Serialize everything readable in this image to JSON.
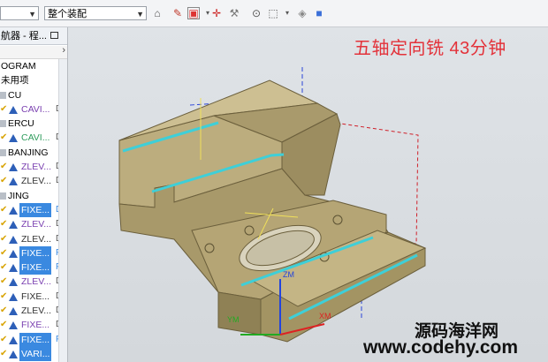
{
  "toolbar": {
    "left_select_value": "",
    "assembly_select_value": "整个装配",
    "icons": [
      "selection-filter-icon",
      "snap-point-icon",
      "select-type-icon",
      "move-icon",
      "point-icon",
      "box-select-icon",
      "shaded-view-icon",
      "cube-view-icon"
    ]
  },
  "navigator": {
    "title": "航器 - 程...",
    "items": [
      {
        "label": "OGRAM",
        "indent": "root"
      },
      {
        "label": "未用项",
        "indent": "root"
      },
      {
        "label": "CU",
        "indent": "group"
      },
      {
        "label": "CAVI...",
        "col": "D",
        "color": "#7a3fb0",
        "selected": false
      },
      {
        "label": "ERCU",
        "indent": "group"
      },
      {
        "label": "CAVI...",
        "col": "D",
        "color": "#2f9c5c",
        "selected": false
      },
      {
        "label": "BANJING",
        "indent": "group"
      },
      {
        "label": "ZLEV...",
        "col": "D",
        "color": "#7a3fb0",
        "selected": false
      },
      {
        "label": "ZLEV...",
        "col": "D",
        "color": "#333333",
        "selected": false
      },
      {
        "label": "JING",
        "indent": "group"
      },
      {
        "label": "FIXE...",
        "col": "D",
        "color": "#ffffff",
        "selected": true
      },
      {
        "label": "ZLEV...",
        "col": "D",
        "color": "#7a3fb0",
        "selected": false
      },
      {
        "label": "ZLEV...",
        "col": "D",
        "color": "#333333",
        "selected": false
      },
      {
        "label": "FIXE...",
        "col": "F",
        "color": "#ffffff",
        "selected": true
      },
      {
        "label": "FIXE...",
        "col": "F",
        "color": "#ffffff",
        "selected": true
      },
      {
        "label": "ZLEV...",
        "col": "D",
        "color": "#7a3fb0",
        "selected": false
      },
      {
        "label": "FIXE...",
        "col": "D",
        "color": "#333333",
        "selected": false
      },
      {
        "label": "ZLEV...",
        "col": "D",
        "color": "#333333",
        "selected": false
      },
      {
        "label": "FIXE...",
        "col": "D",
        "color": "#7a3fb0",
        "selected": false
      },
      {
        "label": "FIXE...",
        "col": "F",
        "color": "#ffffff",
        "selected": true
      },
      {
        "label": "VARI...",
        "col": "",
        "color": "#ffffff",
        "selected": true
      }
    ]
  },
  "viewport": {
    "caption": "五轴定向铣 43分钟",
    "axis_labels": {
      "z": "ZM",
      "y": "YM",
      "x": "XM"
    },
    "watermark_line1": "源码海洋网",
    "watermark_line2": "www.codehy.com",
    "colors": {
      "part": "#b3a274",
      "toolpath": "#3ecfd8",
      "axis_z": "#2244dd",
      "axis_y": "#22aa22",
      "axis_x": "#dd2222",
      "caption": "#e3323a"
    }
  }
}
